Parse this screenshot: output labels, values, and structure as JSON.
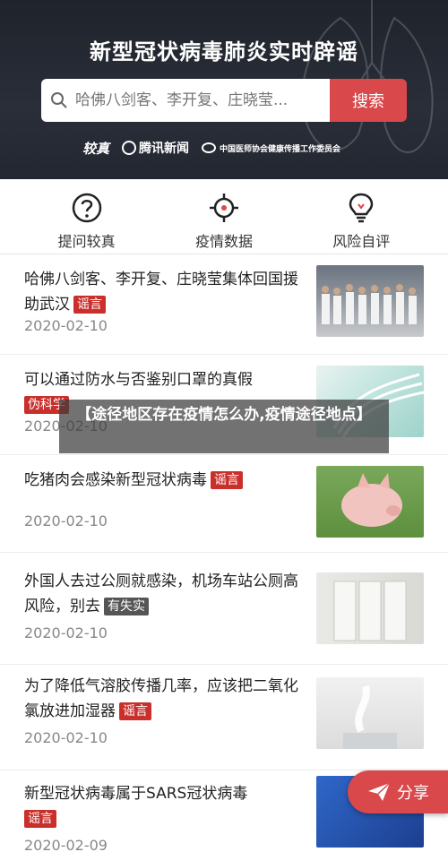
{
  "header": {
    "title": "新型冠状病毒肺炎实时辟谣",
    "search_placeholder": "哈佛八剑客、李开复、庄晓莹...",
    "search_button": "搜索",
    "logos": [
      "较真",
      "腾讯新闻",
      "中国医师协会健康传播工作委员会"
    ]
  },
  "quick_actions": [
    {
      "label": "提问较真",
      "icon": "question-icon"
    },
    {
      "label": "疫情数据",
      "icon": "virus-icon"
    },
    {
      "label": "风险自评",
      "icon": "bulb-icon"
    }
  ],
  "articles": [
    {
      "title": "哈佛八剑客、李开复、庄晓莹集体回国援助武汉",
      "tag": "谣言",
      "date": "2020-02-10"
    },
    {
      "title": "可以通过防水与否鉴别口罩的真假",
      "tag": "伪科学",
      "date": "2020-02-10"
    },
    {
      "title": "吃猪肉会感染新型冠状病毒",
      "tag": "谣言",
      "date": "2020-02-10"
    },
    {
      "title": "外国人去过公厕就感染，机场车站公厕高风险，别去",
      "tag": "有失实",
      "date": "2020-02-10"
    },
    {
      "title": "为了降低气溶胶传播几率，应该把二氧化氯放进加湿器",
      "tag": "谣言",
      "date": "2020-02-10"
    },
    {
      "title": "新型冠状病毒属于SARS冠状病毒",
      "tag": "谣言",
      "date": "2020-02-09"
    }
  ],
  "overlay": {
    "text": "【途径地区存在疫情怎么办,疫情途径地点】"
  },
  "share": {
    "label": "分享"
  },
  "colors": {
    "accent": "#d9484a",
    "header_bg": "#252932"
  }
}
